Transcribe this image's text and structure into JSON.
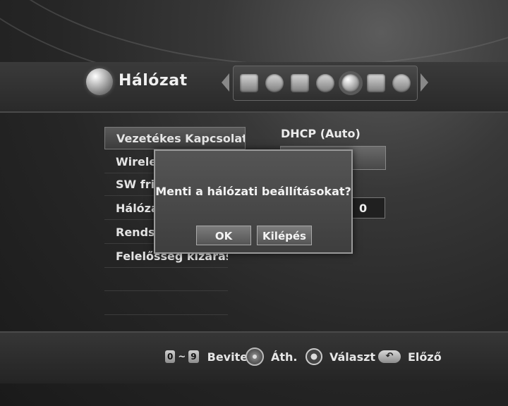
{
  "header": {
    "title": "Hálózat",
    "title_icon": "globe-icon",
    "setup_icons": [
      "display-icon",
      "speaker-icon",
      "screen-icon",
      "gears-icon",
      "network-globe-icon",
      "lock-icon",
      "gear-icon"
    ],
    "active_icon_index": 4
  },
  "menu": {
    "items": [
      {
        "label": "Vezetékes Kapcsolat beáll",
        "selected": true
      },
      {
        "label": "Wireless"
      },
      {
        "label": "SW friss"
      },
      {
        "label": "Hálózati"
      },
      {
        "label": "Rendsze"
      },
      {
        "label": "Felelősség kizárása"
      }
    ]
  },
  "settings": {
    "connection_mode": "DHCP (Auto)",
    "ip_last_octet": "0"
  },
  "dialog": {
    "message": "Menti a hálózati beállításokat?",
    "ok_label": "OK",
    "exit_label": "Kilépés"
  },
  "hints": {
    "digit_from": "0",
    "digit_sep": "~",
    "digit_to": "9",
    "input_label": "Bevitel",
    "navigate_label": "Áth.",
    "select_label": "Választ",
    "back_label": "Előző"
  }
}
